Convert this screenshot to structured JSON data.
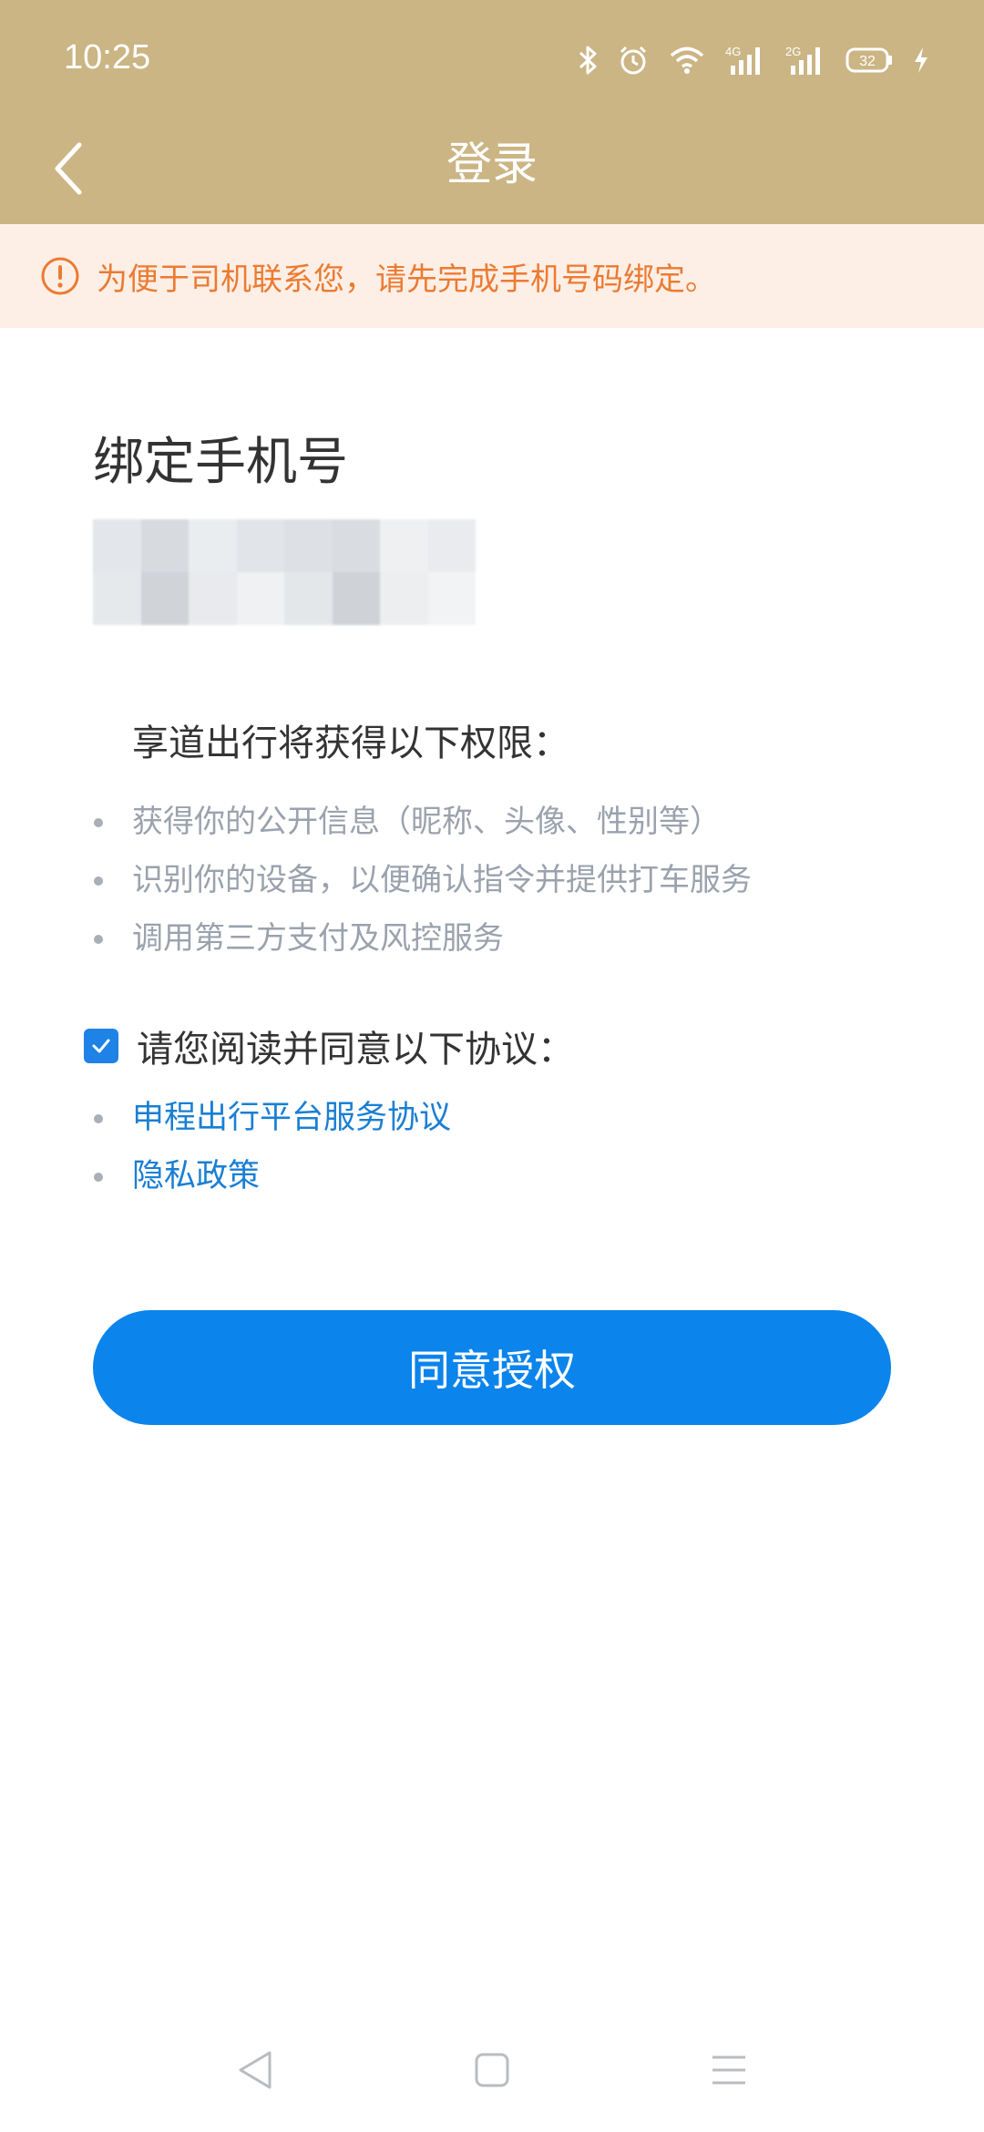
{
  "status_bar": {
    "time": "10:25",
    "icons": [
      "bluetooth-icon",
      "alarm-icon",
      "wifi-icon",
      "signal-4g-icon",
      "signal-2g-icon",
      "battery-icon",
      "charging-icon"
    ],
    "network_labels": [
      "4G",
      "2G"
    ],
    "battery_level": "32"
  },
  "header": {
    "title": "登录",
    "background_color": "#cbb584",
    "back_icon": "chevron-left-icon"
  },
  "notice": {
    "icon": "alert-circle-icon",
    "text": "为便于司机联系您，请先完成手机号码绑定。",
    "background_color": "#fdefe6",
    "text_color": "#ec7b32"
  },
  "main": {
    "title": "绑定手机号",
    "permissions": {
      "heading": "享道出行将获得以下权限：",
      "items": [
        "获得你的公开信息（昵称、头像、性别等）",
        "识别你的设备，以便确认指令并提供打车服务",
        "调用第三方支付及风控服务"
      ]
    },
    "agreement": {
      "checked": true,
      "label": "请您阅读并同意以下协议：",
      "links": [
        "申程出行平台服务协议",
        "隐私政策"
      ]
    },
    "authorize_button": "同意授权",
    "accent_color": "#0b84ec"
  },
  "system_nav": {
    "buttons": [
      "back-triangle-icon",
      "home-square-icon",
      "menu-lines-icon"
    ]
  }
}
